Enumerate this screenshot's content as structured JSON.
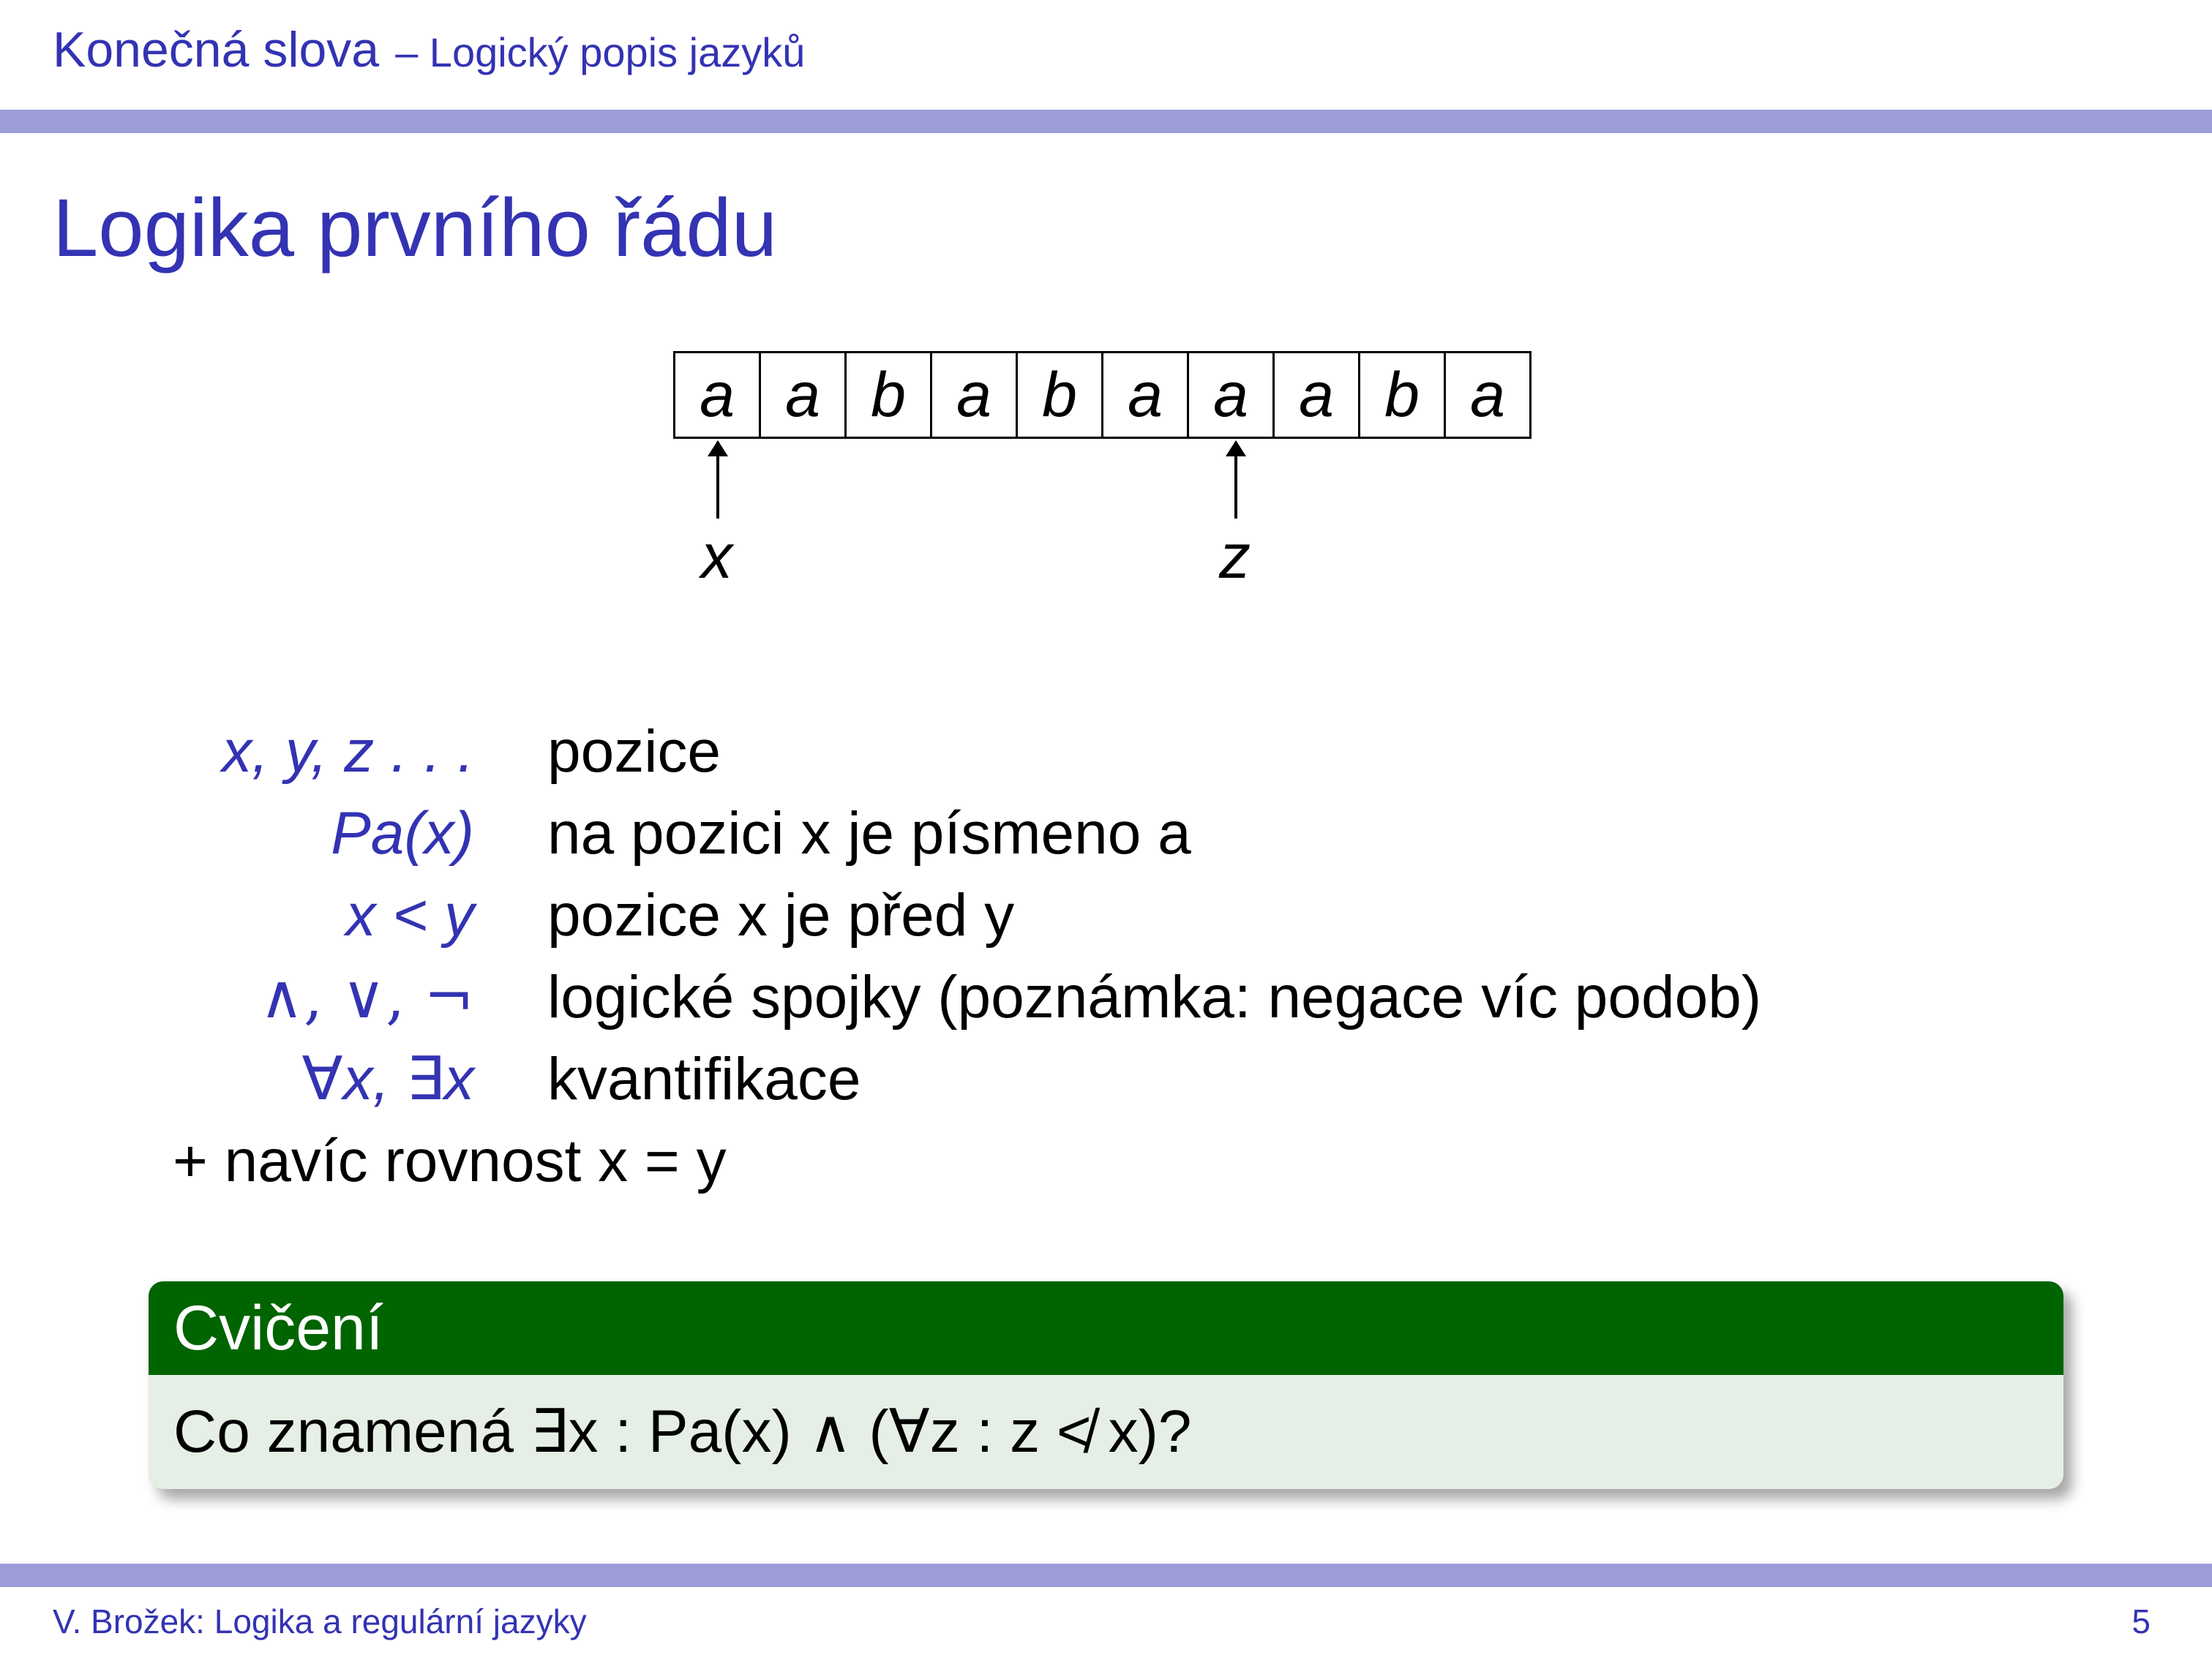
{
  "header": {
    "title": "Konečná slova",
    "section": "– Logický popis jazyků"
  },
  "frame": {
    "title": "Logika prvního řádu"
  },
  "tape": {
    "cells": [
      "a",
      "a",
      "b",
      "a",
      "b",
      "a",
      "a",
      "a",
      "b",
      "a"
    ],
    "pointers": [
      {
        "label": "x",
        "cell_index": 0
      },
      {
        "label": "z",
        "cell_index": 6
      }
    ]
  },
  "definitions": {
    "rows": [
      {
        "symbol": "x, y, z . . .",
        "text": "pozice"
      },
      {
        "symbol": "Pa(x)",
        "text": "na pozici x je písmeno a"
      },
      {
        "symbol": "x < y",
        "text": "pozice x je před y"
      },
      {
        "symbol": "∧, ∨, ¬",
        "text": "logické spojky (poznámka: negace víc podob)"
      },
      {
        "symbol": "∀x, ∃x",
        "text": "kvantifikace"
      }
    ],
    "extra": "+ navíc rovnost x = y"
  },
  "exercise": {
    "title": "Cvičení",
    "question": "Co znamená ∃x : Pa(x) ∧ (∀z : z ≮ x)?"
  },
  "footer": {
    "author": "V. Brožek: Logika a regulární jazyky",
    "page": "5"
  },
  "colors": {
    "theme_blue": "#3333b3",
    "bar": "#9d9dd9",
    "block_head": "#006400",
    "block_body": "#e6efe6"
  }
}
